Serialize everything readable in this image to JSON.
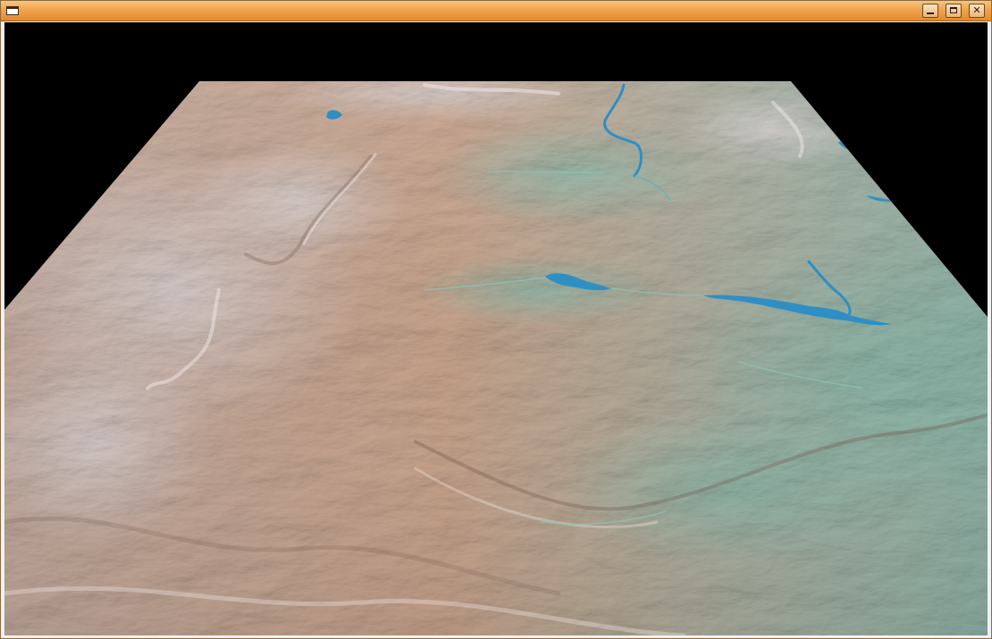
{
  "window": {
    "title": "",
    "controls": {
      "minimize_icon": "minimize-icon",
      "maximize_icon": "maximize-icon",
      "close_icon": "close-icon",
      "close_glyph": "✕"
    }
  },
  "scene": {
    "type": "3d-terrain-render",
    "background_color": "#000000",
    "terrain_colors": {
      "highland": "#b7a79f",
      "plain": "#c9a48c",
      "lowland": "#8fb2a2",
      "water": "#2e8fc4",
      "shadow": "#7d6559",
      "highlight": "#e7dcd8"
    }
  }
}
